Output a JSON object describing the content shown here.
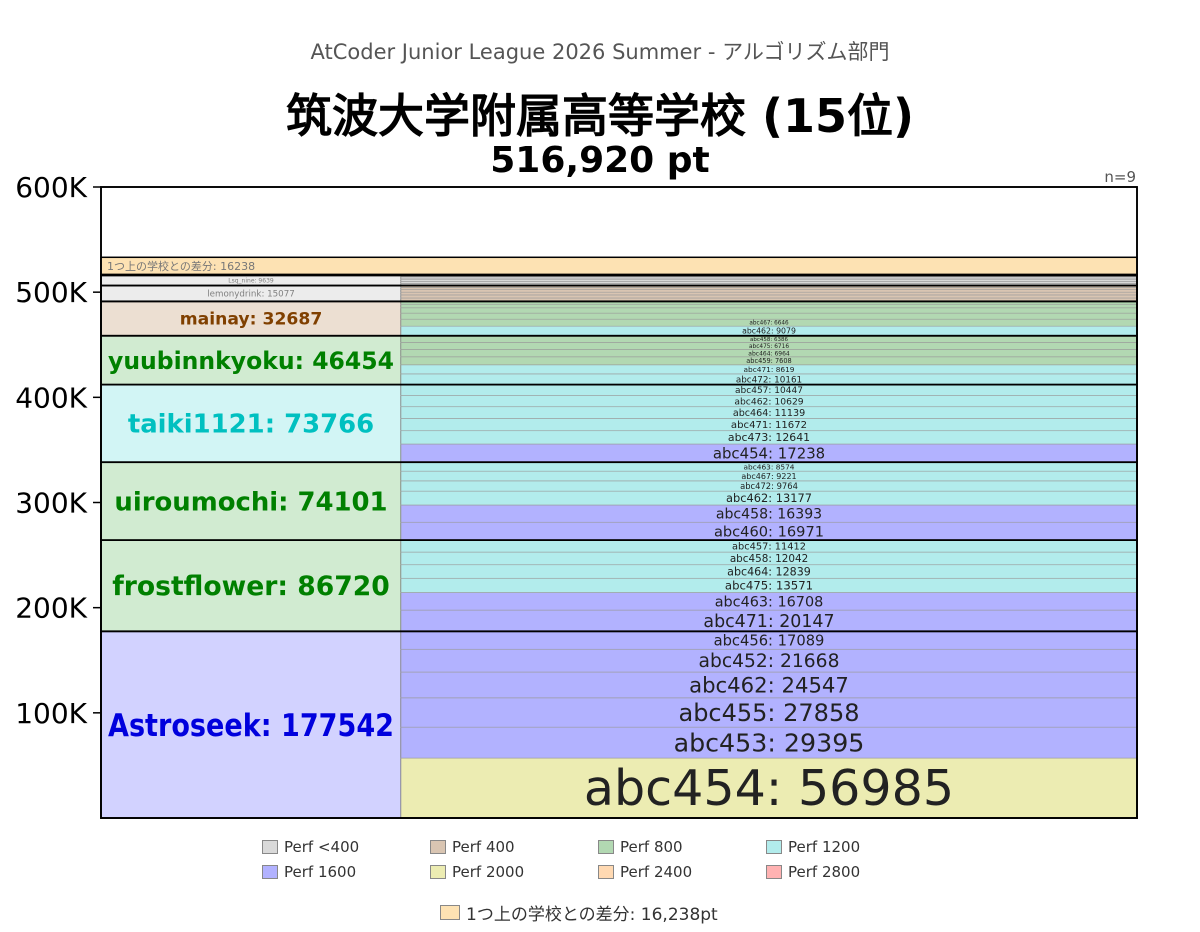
{
  "header": {
    "league": "AtCoder Junior League 2026 Summer - アルゴリズム部門",
    "school_title": "筑波大学附属高等学校 (15位)",
    "total": "516,920 pt",
    "n_label": "n=9"
  },
  "colors": {
    "Perf <400": "#d9d9d9",
    "Perf 400": "#d9c5b2",
    "Perf 800": "#b2d8b2",
    "Perf 1200": "#b2ecec",
    "Perf 1600": "#b2b2ff",
    "Perf 2000": "#ececb2",
    "Perf 2400": "#ffd9b2",
    "Perf 2800": "#ffb2b2",
    "gap": "#fde2b3"
  },
  "legend": {
    "items": [
      "Perf <400",
      "Perf 400",
      "Perf 800",
      "Perf 1200",
      "Perf 1600",
      "Perf 2000",
      "Perf 2400",
      "Perf 2800"
    ],
    "gap_label": "1つ上の学校との差分: 16,238pt"
  },
  "chart_data": {
    "type": "stacked-bar",
    "ylim": [
      0,
      600000
    ],
    "y_ticks": [
      100000,
      200000,
      300000,
      400000,
      500000,
      600000
    ],
    "y_tick_labels": [
      "100K",
      "200K",
      "300K",
      "400K",
      "500K",
      "600K"
    ],
    "gap": {
      "label": "1つ上の学校との差分: 16238",
      "value": 16238
    },
    "members": [
      {
        "label": "Astroseek: 177542",
        "total": 177542,
        "color": "#0000dd",
        "bg": "#d2d2ff",
        "contests": [
          {
            "label": "abc454: 56985",
            "value": 56985,
            "perf": "Perf 2000"
          },
          {
            "label": "abc453: 29395",
            "value": 29395,
            "perf": "Perf 1600"
          },
          {
            "label": "abc455: 27858",
            "value": 27858,
            "perf": "Perf 1600"
          },
          {
            "label": "abc462: 24547",
            "value": 24547,
            "perf": "Perf 1600"
          },
          {
            "label": "abc452: 21668",
            "value": 21668,
            "perf": "Perf 1600"
          },
          {
            "label": "abc456: 17089",
            "value": 17089,
            "perf": "Perf 1600"
          }
        ]
      },
      {
        "label": "frostflower: 86720",
        "total": 86720,
        "color": "#008000",
        "bg": "#d1ebd1",
        "contests": [
          {
            "label": "abc471: 20147",
            "value": 20147,
            "perf": "Perf 1600"
          },
          {
            "label": "abc463: 16708",
            "value": 16708,
            "perf": "Perf 1600"
          },
          {
            "label": "abc475: 13571",
            "value": 13571,
            "perf": "Perf 1200"
          },
          {
            "label": "abc464: 12839",
            "value": 12839,
            "perf": "Perf 1200"
          },
          {
            "label": "abc458: 12042",
            "value": 12042,
            "perf": "Perf 1200"
          },
          {
            "label": "abc457: 11412",
            "value": 11412,
            "perf": "Perf 1200"
          }
        ]
      },
      {
        "label": "uiroumochi: 74101",
        "total": 74101,
        "color": "#008000",
        "bg": "#d1ebd1",
        "contests": [
          {
            "label": "abc460: 16971",
            "value": 16971,
            "perf": "Perf 1600"
          },
          {
            "label": "abc458: 16393",
            "value": 16393,
            "perf": "Perf 1600"
          },
          {
            "label": "abc462: 13177",
            "value": 13177,
            "perf": "Perf 1200"
          },
          {
            "label": "abc472: 9764",
            "value": 9764,
            "perf": "Perf 1200"
          },
          {
            "label": "abc467: 9221",
            "value": 9221,
            "perf": "Perf 1200"
          },
          {
            "label": "abc463: 8574",
            "value": 8574,
            "perf": "Perf 1200"
          }
        ]
      },
      {
        "label": "taiki1121: 73766",
        "total": 73766,
        "color": "#00c0c0",
        "bg": "#d2f5f5",
        "contests": [
          {
            "label": "abc454: 17238",
            "value": 17238,
            "perf": "Perf 1600"
          },
          {
            "label": "abc473: 12641",
            "value": 12641,
            "perf": "Perf 1200"
          },
          {
            "label": "abc471: 11672",
            "value": 11672,
            "perf": "Perf 1200"
          },
          {
            "label": "abc464: 11139",
            "value": 11139,
            "perf": "Perf 1200"
          },
          {
            "label": "abc462: 10629",
            "value": 10629,
            "perf": "Perf 1200"
          },
          {
            "label": "abc457: 10447",
            "value": 10447,
            "perf": "Perf 1200"
          }
        ]
      },
      {
        "label": "yuubinnkyoku: 46454",
        "total": 46454,
        "color": "#008000",
        "bg": "#d1ebd1",
        "contests": [
          {
            "label": "abc472: 10161",
            "value": 10161,
            "perf": "Perf 1200"
          },
          {
            "label": "abc471: 8619",
            "value": 8619,
            "perf": "Perf 1200"
          },
          {
            "label": "abc459: 7608",
            "value": 7608,
            "perf": "Perf 800"
          },
          {
            "label": "abc464: 6964",
            "value": 6964,
            "perf": "Perf 800"
          },
          {
            "label": "abc475: 6716",
            "value": 6716,
            "perf": "Perf 800"
          },
          {
            "label": "abc458: 6386",
            "value": 6386,
            "perf": "Perf 800"
          }
        ]
      },
      {
        "label": "mainay: 32687",
        "total": 32687,
        "color": "#804000",
        "bg": "#ecdfd2",
        "contests": [
          {
            "label": "abc462: 9079",
            "value": 9079,
            "perf": "Perf 1200"
          },
          {
            "label": "abc467: 6646",
            "value": 6646,
            "perf": "Perf 800"
          },
          {
            "label": "",
            "value": 5740,
            "perf": "Perf 800"
          },
          {
            "label": "",
            "value": 5080,
            "perf": "Perf 800"
          },
          {
            "label": "",
            "value": 3390,
            "perf": "Perf 800"
          },
          {
            "label": "",
            "value": 2752,
            "perf": "Perf 800"
          }
        ]
      },
      {
        "label": "lemonydrink: 15077",
        "total": 15077,
        "color": "#808080",
        "bg": "#ececec",
        "contests": [
          {
            "label": "",
            "value": 3200,
            "perf": "Perf 400"
          },
          {
            "label": "",
            "value": 2900,
            "perf": "Perf 400"
          },
          {
            "label": "",
            "value": 2600,
            "perf": "Perf 400"
          },
          {
            "label": "",
            "value": 2400,
            "perf": "Perf 400"
          },
          {
            "label": "",
            "value": 2100,
            "perf": "Perf 400"
          },
          {
            "label": "",
            "value": 1877,
            "perf": "Perf 400"
          }
        ]
      },
      {
        "label": "Lsq_nine: 9639",
        "total": 9639,
        "color": "#808080",
        "bg": "#ececec",
        "contests": [
          {
            "label": "",
            "value": 2000,
            "perf": "Perf <400"
          },
          {
            "label": "",
            "value": 1800,
            "perf": "Perf <400"
          },
          {
            "label": "",
            "value": 1700,
            "perf": "Perf <400"
          },
          {
            "label": "",
            "value": 1600,
            "perf": "Perf <400"
          },
          {
            "label": "",
            "value": 1400,
            "perf": "Perf <400"
          },
          {
            "label": "",
            "value": 1139,
            "perf": "Perf <400"
          }
        ]
      },
      {
        "label": "",
        "total": 933,
        "color": "#808080",
        "bg": "#ececec",
        "contests": [
          {
            "label": "",
            "value": 933,
            "perf": "Perf <400"
          }
        ]
      }
    ]
  }
}
